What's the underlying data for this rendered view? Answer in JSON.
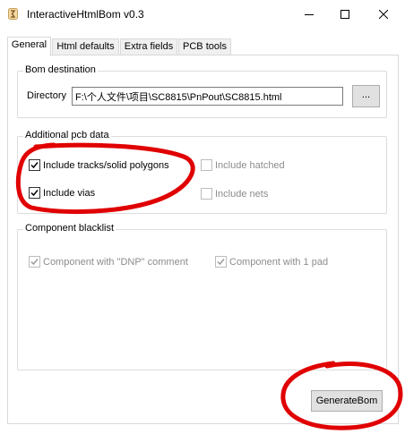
{
  "window": {
    "title": "InteractiveHtmlBom v0.3"
  },
  "tabs": [
    {
      "label": "General"
    },
    {
      "label": "Html defaults"
    },
    {
      "label": "Extra fields"
    },
    {
      "label": "PCB tools"
    }
  ],
  "bom_destination": {
    "legend": "Bom destination",
    "directory_label": "Directory",
    "directory_value": "F:\\个人文件\\项目\\SC8815\\PnPout\\SC8815.html",
    "browse_label": "..."
  },
  "additional_pcb_data": {
    "legend": "Additional pcb data",
    "options": [
      {
        "label": "Include tracks/solid polygons",
        "checked": true,
        "enabled": true
      },
      {
        "label": "Include vias",
        "checked": true,
        "enabled": true
      },
      {
        "label": "Include hatched",
        "checked": false,
        "enabled": false
      },
      {
        "label": "Include nets",
        "checked": false,
        "enabled": false
      }
    ]
  },
  "component_blacklist": {
    "legend": "Component blacklist",
    "options": [
      {
        "label": "Component with \"DNP\" comment",
        "checked": true,
        "enabled": false
      },
      {
        "label": "Component with 1 pad",
        "checked": true,
        "enabled": false
      }
    ]
  },
  "generate_label": "GenerateBom",
  "colors": {
    "annotation": "#e00000",
    "disabled_text": "#8c8c8c"
  }
}
